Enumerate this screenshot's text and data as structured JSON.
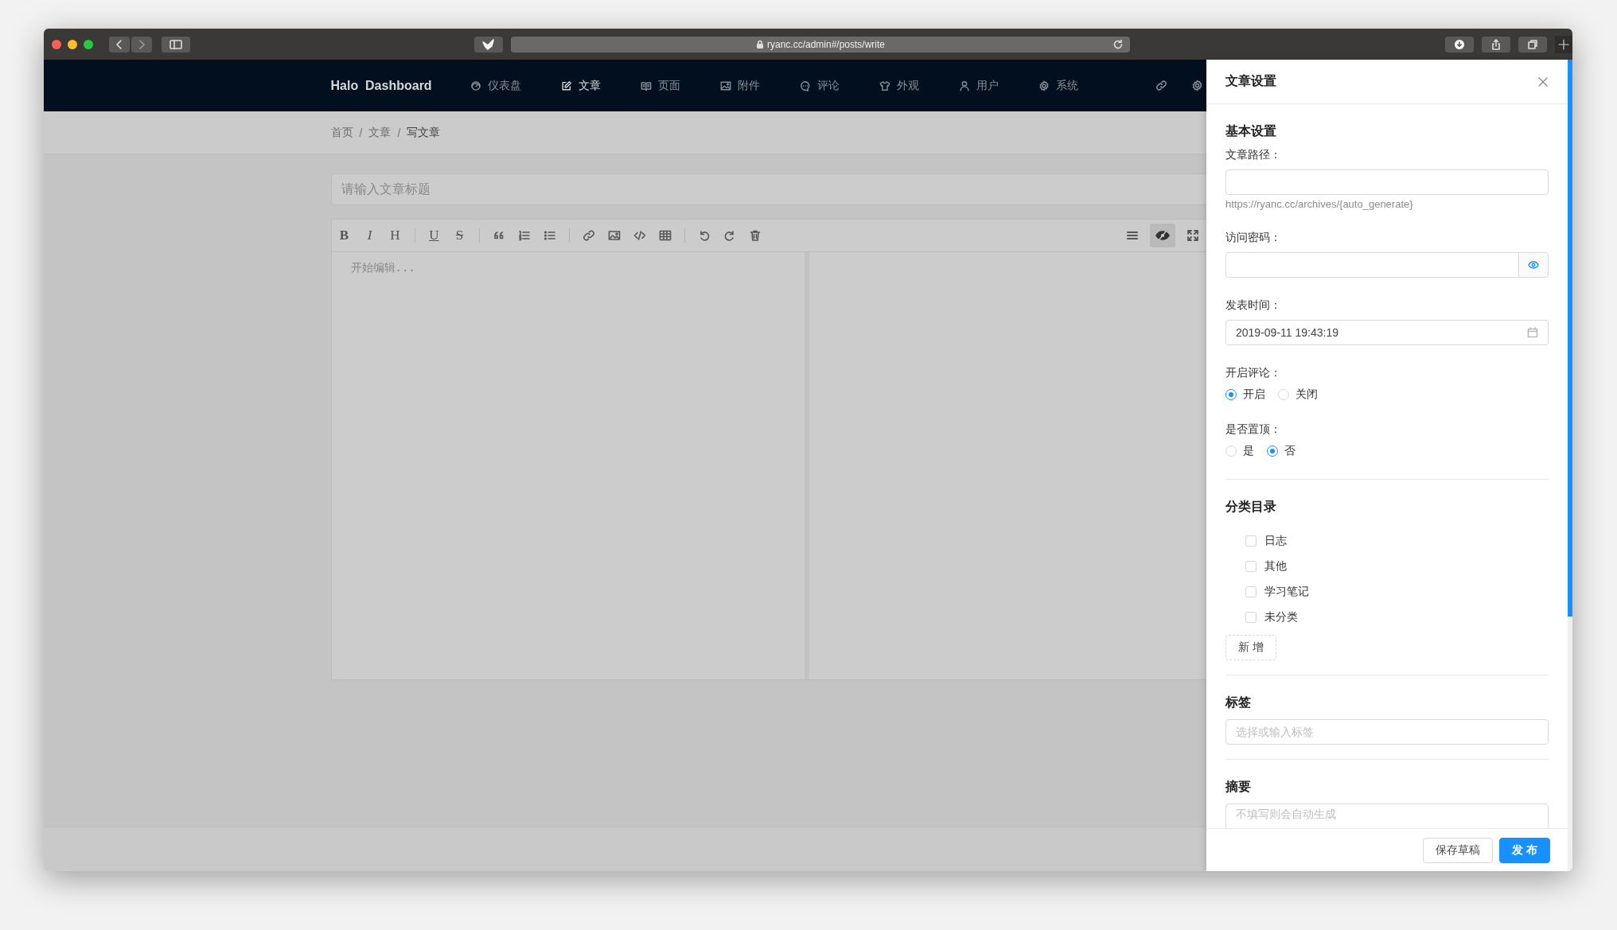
{
  "browser": {
    "url": "ryanc.cc/admin#/posts/write"
  },
  "nav": {
    "brand": "Halo  Dashboard",
    "items": [
      {
        "label": "仪表盘",
        "selected": false
      },
      {
        "label": "文章",
        "selected": true
      },
      {
        "label": "页面",
        "selected": false
      },
      {
        "label": "附件",
        "selected": false
      },
      {
        "label": "评论",
        "selected": false
      },
      {
        "label": "外观",
        "selected": false
      },
      {
        "label": "用户",
        "selected": false
      },
      {
        "label": "系统",
        "selected": false
      }
    ]
  },
  "breadcrumb": {
    "separator": "/",
    "items": [
      "首页",
      "文章",
      "写文章"
    ]
  },
  "title_input": {
    "placeholder": "请输入文章标题"
  },
  "editor": {
    "tools": [
      {
        "kind": "letter",
        "text": "B"
      },
      {
        "kind": "letter",
        "text": "I"
      },
      {
        "kind": "letter",
        "text": "H"
      },
      {
        "kind": "divider"
      },
      {
        "kind": "letter",
        "text": "U"
      },
      {
        "kind": "letter",
        "text": "S"
      },
      {
        "kind": "divider"
      },
      {
        "kind": "icon"
      },
      {
        "kind": "icon"
      },
      {
        "kind": "icon"
      },
      {
        "kind": "divider"
      },
      {
        "kind": "icon"
      },
      {
        "kind": "icon"
      },
      {
        "kind": "icon"
      },
      {
        "kind": "icon"
      },
      {
        "kind": "divider"
      },
      {
        "kind": "icon"
      },
      {
        "kind": "icon"
      },
      {
        "kind": "icon"
      }
    ],
    "preview_selected": true,
    "placeholder": "开始编辑..."
  },
  "drawer": {
    "title": "文章设置",
    "basic": {
      "heading": "基本设置",
      "fields": [
        {
          "kind": "text",
          "label": "文章路径：",
          "hint": "https://ryanc.cc/archives/{auto_generate}"
        },
        {
          "kind": "password",
          "label": "访问密码："
        },
        {
          "kind": "date",
          "label": "发表时间：",
          "value": "2019-09-11 19:43:19"
        },
        {
          "kind": "radio",
          "label": "开启评论：",
          "options": [
            {
              "label": "开启",
              "selected": true
            },
            {
              "label": "关闭",
              "selected": false
            }
          ]
        },
        {
          "kind": "radio",
          "label": "是否置顶：",
          "options": [
            {
              "label": "是",
              "selected": false
            },
            {
              "label": "否",
              "selected": true
            }
          ]
        }
      ]
    },
    "categories": {
      "heading": "分类目录",
      "items": [
        {
          "label": "日志",
          "checked": false
        },
        {
          "label": "其他",
          "checked": false
        },
        {
          "label": "学习笔记",
          "checked": false
        },
        {
          "label": "未分类",
          "checked": false
        }
      ],
      "add_button": "新 增"
    },
    "tags": {
      "heading": "标签",
      "placeholder": "选择或输入标签"
    },
    "summary": {
      "heading": "摘要",
      "placeholder": "不填写则会自动生成"
    },
    "buttons": {
      "save": "保存草稿",
      "publish": "发 布"
    }
  }
}
